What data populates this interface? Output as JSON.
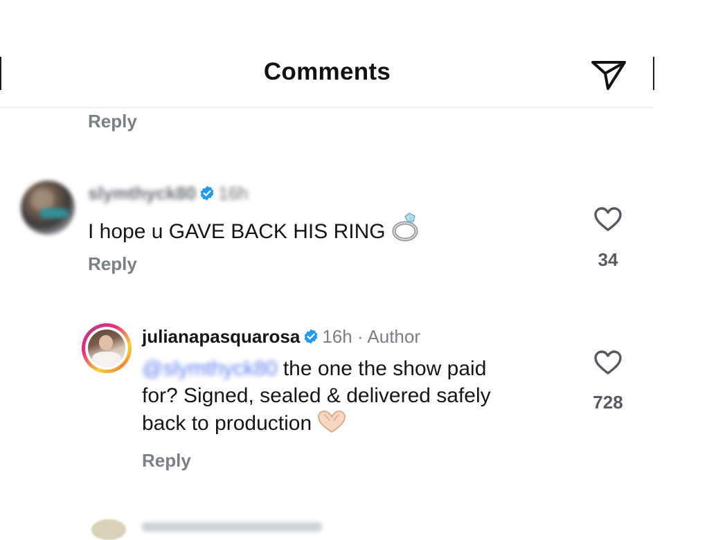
{
  "header": {
    "title": "Comments",
    "send_icon": "paper-plane-icon"
  },
  "thread": {
    "top_reply_label": "Reply"
  },
  "comment1": {
    "username": "slymthyck80",
    "time": "16h",
    "text": "I hope u GAVE BACK HIS RING",
    "emoji": "ring",
    "reply_label": "Reply",
    "likes": "34",
    "verified": true
  },
  "comment2": {
    "username": "julianapasquarosa",
    "time": "16h",
    "separator": "·",
    "role": "Author",
    "mention": "@slymthyck80",
    "text_line1": "the one the show paid",
    "text_line2": "for? Signed, sealed & delivered safely",
    "text_line3": "back to production",
    "emoji": "heart-hands",
    "reply_label": "Reply",
    "likes": "728",
    "verified": true
  },
  "colors": {
    "accent_blue": "#1d9bf0",
    "muted_text": "#7a7f85",
    "story_ring": [
      "#f9ce34",
      "#ee2a7b",
      "#c13584"
    ]
  }
}
